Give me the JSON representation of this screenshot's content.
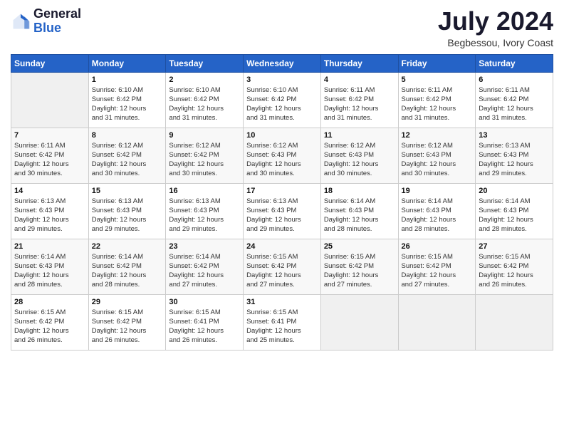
{
  "header": {
    "logo_general": "General",
    "logo_blue": "Blue",
    "month_year": "July 2024",
    "location": "Begbessou, Ivory Coast"
  },
  "days_of_week": [
    "Sunday",
    "Monday",
    "Tuesday",
    "Wednesday",
    "Thursday",
    "Friday",
    "Saturday"
  ],
  "weeks": [
    [
      {
        "day": "",
        "detail": ""
      },
      {
        "day": "1",
        "detail": "Sunrise: 6:10 AM\nSunset: 6:42 PM\nDaylight: 12 hours\nand 31 minutes."
      },
      {
        "day": "2",
        "detail": "Sunrise: 6:10 AM\nSunset: 6:42 PM\nDaylight: 12 hours\nand 31 minutes."
      },
      {
        "day": "3",
        "detail": "Sunrise: 6:10 AM\nSunset: 6:42 PM\nDaylight: 12 hours\nand 31 minutes."
      },
      {
        "day": "4",
        "detail": "Sunrise: 6:11 AM\nSunset: 6:42 PM\nDaylight: 12 hours\nand 31 minutes."
      },
      {
        "day": "5",
        "detail": "Sunrise: 6:11 AM\nSunset: 6:42 PM\nDaylight: 12 hours\nand 31 minutes."
      },
      {
        "day": "6",
        "detail": "Sunrise: 6:11 AM\nSunset: 6:42 PM\nDaylight: 12 hours\nand 31 minutes."
      }
    ],
    [
      {
        "day": "7",
        "detail": "Sunrise: 6:11 AM\nSunset: 6:42 PM\nDaylight: 12 hours\nand 30 minutes."
      },
      {
        "day": "8",
        "detail": "Sunrise: 6:12 AM\nSunset: 6:42 PM\nDaylight: 12 hours\nand 30 minutes."
      },
      {
        "day": "9",
        "detail": "Sunrise: 6:12 AM\nSunset: 6:42 PM\nDaylight: 12 hours\nand 30 minutes."
      },
      {
        "day": "10",
        "detail": "Sunrise: 6:12 AM\nSunset: 6:43 PM\nDaylight: 12 hours\nand 30 minutes."
      },
      {
        "day": "11",
        "detail": "Sunrise: 6:12 AM\nSunset: 6:43 PM\nDaylight: 12 hours\nand 30 minutes."
      },
      {
        "day": "12",
        "detail": "Sunrise: 6:12 AM\nSunset: 6:43 PM\nDaylight: 12 hours\nand 30 minutes."
      },
      {
        "day": "13",
        "detail": "Sunrise: 6:13 AM\nSunset: 6:43 PM\nDaylight: 12 hours\nand 29 minutes."
      }
    ],
    [
      {
        "day": "14",
        "detail": "Sunrise: 6:13 AM\nSunset: 6:43 PM\nDaylight: 12 hours\nand 29 minutes."
      },
      {
        "day": "15",
        "detail": "Sunrise: 6:13 AM\nSunset: 6:43 PM\nDaylight: 12 hours\nand 29 minutes."
      },
      {
        "day": "16",
        "detail": "Sunrise: 6:13 AM\nSunset: 6:43 PM\nDaylight: 12 hours\nand 29 minutes."
      },
      {
        "day": "17",
        "detail": "Sunrise: 6:13 AM\nSunset: 6:43 PM\nDaylight: 12 hours\nand 29 minutes."
      },
      {
        "day": "18",
        "detail": "Sunrise: 6:14 AM\nSunset: 6:43 PM\nDaylight: 12 hours\nand 28 minutes."
      },
      {
        "day": "19",
        "detail": "Sunrise: 6:14 AM\nSunset: 6:43 PM\nDaylight: 12 hours\nand 28 minutes."
      },
      {
        "day": "20",
        "detail": "Sunrise: 6:14 AM\nSunset: 6:43 PM\nDaylight: 12 hours\nand 28 minutes."
      }
    ],
    [
      {
        "day": "21",
        "detail": "Sunrise: 6:14 AM\nSunset: 6:43 PM\nDaylight: 12 hours\nand 28 minutes."
      },
      {
        "day": "22",
        "detail": "Sunrise: 6:14 AM\nSunset: 6:42 PM\nDaylight: 12 hours\nand 28 minutes."
      },
      {
        "day": "23",
        "detail": "Sunrise: 6:14 AM\nSunset: 6:42 PM\nDaylight: 12 hours\nand 27 minutes."
      },
      {
        "day": "24",
        "detail": "Sunrise: 6:15 AM\nSunset: 6:42 PM\nDaylight: 12 hours\nand 27 minutes."
      },
      {
        "day": "25",
        "detail": "Sunrise: 6:15 AM\nSunset: 6:42 PM\nDaylight: 12 hours\nand 27 minutes."
      },
      {
        "day": "26",
        "detail": "Sunrise: 6:15 AM\nSunset: 6:42 PM\nDaylight: 12 hours\nand 27 minutes."
      },
      {
        "day": "27",
        "detail": "Sunrise: 6:15 AM\nSunset: 6:42 PM\nDaylight: 12 hours\nand 26 minutes."
      }
    ],
    [
      {
        "day": "28",
        "detail": "Sunrise: 6:15 AM\nSunset: 6:42 PM\nDaylight: 12 hours\nand 26 minutes."
      },
      {
        "day": "29",
        "detail": "Sunrise: 6:15 AM\nSunset: 6:42 PM\nDaylight: 12 hours\nand 26 minutes."
      },
      {
        "day": "30",
        "detail": "Sunrise: 6:15 AM\nSunset: 6:41 PM\nDaylight: 12 hours\nand 26 minutes."
      },
      {
        "day": "31",
        "detail": "Sunrise: 6:15 AM\nSunset: 6:41 PM\nDaylight: 12 hours\nand 25 minutes."
      },
      {
        "day": "",
        "detail": ""
      },
      {
        "day": "",
        "detail": ""
      },
      {
        "day": "",
        "detail": ""
      }
    ]
  ]
}
